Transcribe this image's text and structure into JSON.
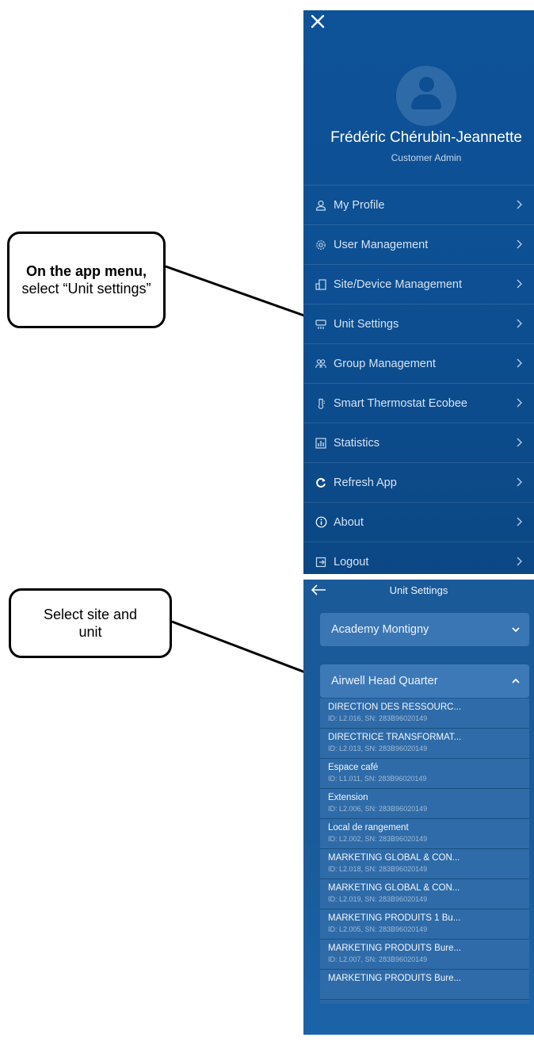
{
  "callouts": {
    "menu": {
      "bold": "On the app menu,",
      "rest": " select “Unit settings”"
    },
    "site": {
      "text": "Select site and unit"
    }
  },
  "menu": {
    "user": {
      "name": "Frédéric Chérubin-Jeannette",
      "role": "Customer Admin"
    },
    "items": [
      {
        "label": "My Profile",
        "icon": "user-icon"
      },
      {
        "label": "User Management",
        "icon": "gear-icon"
      },
      {
        "label": "Site/Device Management",
        "icon": "building-icon"
      },
      {
        "label": "Unit Settings",
        "icon": "air-conditioner-icon"
      },
      {
        "label": "Group Management",
        "icon": "group-icon"
      },
      {
        "label": "Smart Thermostat Ecobee",
        "icon": "thermometer-icon"
      },
      {
        "label": "Statistics",
        "icon": "chart-icon"
      },
      {
        "label": "Refresh App",
        "icon": "refresh-icon"
      },
      {
        "label": "About",
        "icon": "info-icon"
      },
      {
        "label": "Logout",
        "icon": "logout-icon"
      }
    ]
  },
  "unit_settings": {
    "title": "Unit Settings",
    "sites": [
      {
        "label": "Academy Montigny",
        "expanded": false
      },
      {
        "label": "Airwell Head Quarter",
        "expanded": true
      }
    ],
    "units": [
      {
        "name": "DIRECTION DES RESSOURC...",
        "meta": "ID: L2.016, SN: 283B96020149"
      },
      {
        "name": "DIRECTRICE TRANSFORMAT...",
        "meta": "ID: L2.013, SN: 283B96020149"
      },
      {
        "name": "Espace café",
        "meta": "ID: L1.011, SN: 283B96020149"
      },
      {
        "name": "Extension",
        "meta": "ID: L2.006, SN: 283B96020149"
      },
      {
        "name": "Local de rangement",
        "meta": "ID: L2.002, SN: 283B96020149"
      },
      {
        "name": "MARKETING GLOBAL & CON...",
        "meta": "ID: L2.018, SN: 283B96020149"
      },
      {
        "name": "MARKETING GLOBAL & CON...",
        "meta": "ID: L2.019, SN: 283B96020149"
      },
      {
        "name": "MARKETING PRODUITS 1 Bu...",
        "meta": "ID: L2.005, SN: 283B96020149"
      },
      {
        "name": "MARKETING PRODUITS Bure...",
        "meta": "ID: L2.007, SN: 283B96020149"
      },
      {
        "name": "MARKETING PRODUITS Bure...",
        "meta": ""
      }
    ]
  },
  "colors": {
    "panel_blue": "#0d4f92",
    "accent_light": "#d6e3f3"
  }
}
